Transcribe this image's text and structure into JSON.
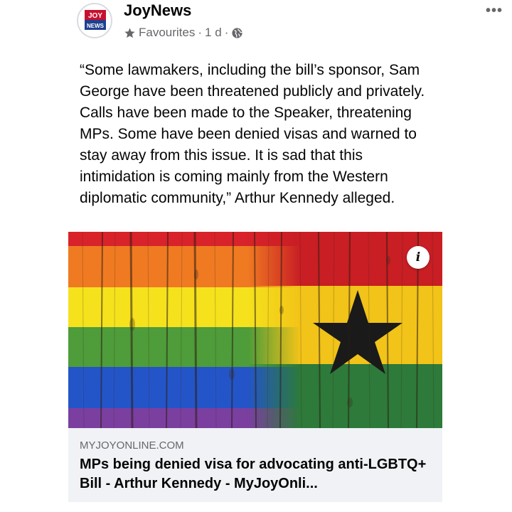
{
  "post": {
    "page_name": "JoyNews",
    "logo_top": "JOY",
    "logo_bottom": "NEWS",
    "favourites_label": "Favourites",
    "separator": "·",
    "time": "1 d",
    "more_label": "•••",
    "body_text": "“Some lawmakers, including the bill’s sponsor, Sam George have been threatened publicly and privately. Calls have been made to the Speaker, threatening MPs. Some have been denied visas and warned to stay away from this issue. It is sad that this intimidation is coming mainly from the Western diplomatic community,” Arthur Kennedy alleged."
  },
  "link_preview": {
    "info_label": "i",
    "domain": "MYJOYONLINE.COM",
    "title": "MPs being denied visa for advocating anti-LGBTQ+ Bill - Arthur Kennedy - MyJoyOnli..."
  },
  "colors": {
    "rainbow": [
      "#d8232a",
      "#f07a22",
      "#f5e21d",
      "#4e9c3a",
      "#2455c8",
      "#7b3fa0"
    ],
    "ghana": [
      "#c81e24",
      "#f2c318",
      "#2d7a3a"
    ],
    "star": "#1a1a1a",
    "meta_text": "#65676b",
    "card_bg": "#f0f2f5"
  }
}
